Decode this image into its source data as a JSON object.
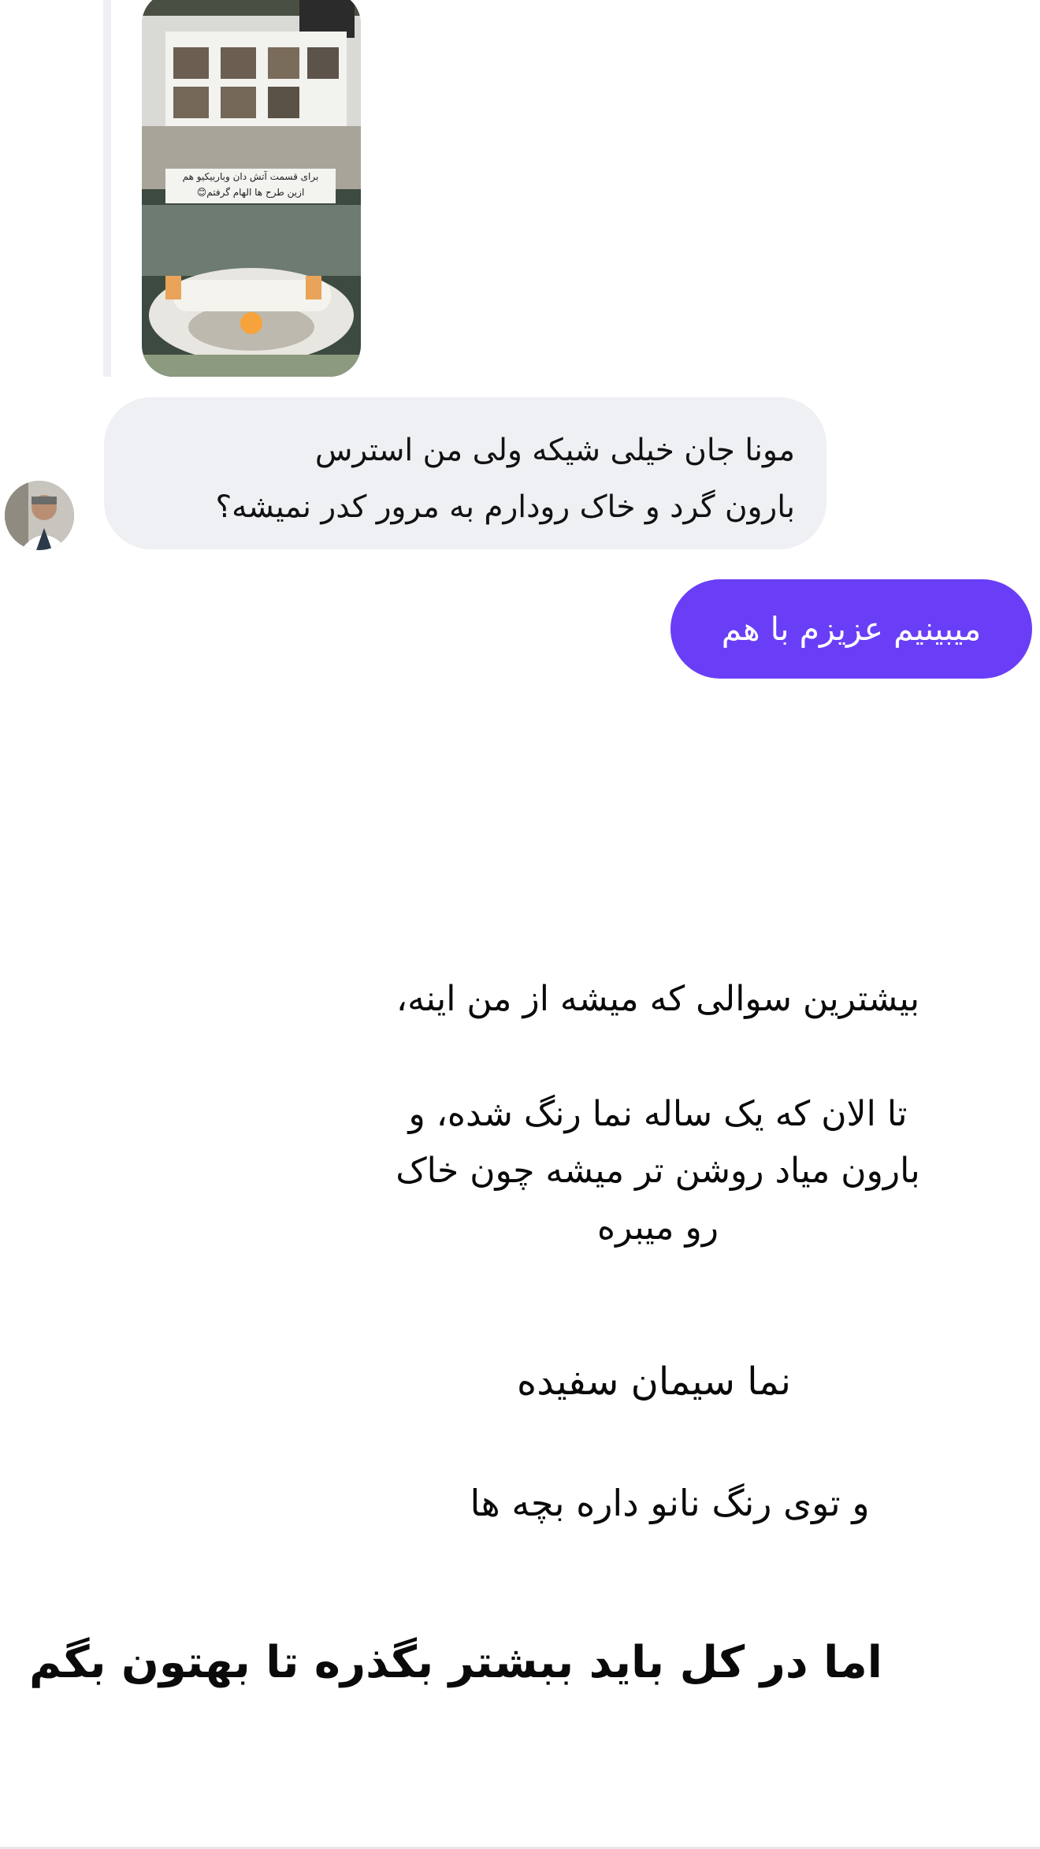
{
  "shared_post": {
    "caption_line1": "برای قسمت آتش دان وباربیکیو هم",
    "caption_line2": "ازین طرح ها الهام گرفتم😊"
  },
  "received_message": {
    "line1": "مونا جان خیلی شیکه ولی من استرس",
    "line2": "بارون گرد و خاک رودارم به مرور کدر نمیشه؟"
  },
  "sent_message": {
    "text": "میبینیم عزیزم با هم"
  },
  "story_text": {
    "line1": "بیشترین سوالی که میشه از من اینه،",
    "line2": "تا الان که یک ساله نما رنگ شده، و",
    "line3": "بارون میاد روشن تر میشه چون خاک",
    "line4": "رو میبره",
    "line5": "نما سیمان سفیده",
    "line6": "و توی رنگ نانو داره بچه ها",
    "line7": "اما در کل باید ببشتر بگذره تا بهتون بگم"
  },
  "colors": {
    "sent_bubble": "#6a3ef6",
    "received_bubble": "#eff0f3"
  }
}
